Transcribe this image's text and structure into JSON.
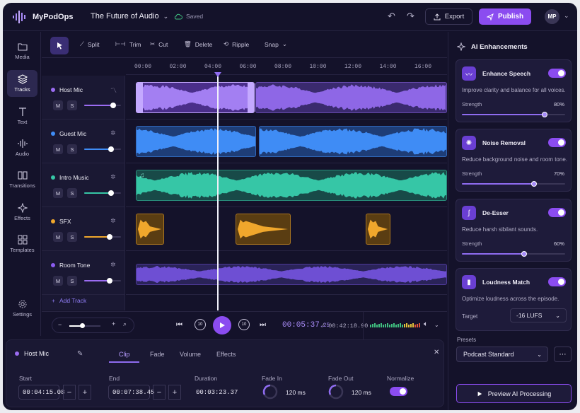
{
  "app": {
    "name": "MyPodOps",
    "doc_title": "The Future of Audio",
    "saved": "Saved"
  },
  "topbar": {
    "export": "Export",
    "publish": "Publish",
    "avatar": "MP"
  },
  "nav": [
    {
      "label": "Media",
      "icon": "folder-icon"
    },
    {
      "label": "Tracks",
      "icon": "layers-icon",
      "active": true
    },
    {
      "label": "Text",
      "icon": "text-icon"
    },
    {
      "label": "Audio",
      "icon": "waveform-icon"
    },
    {
      "label": "Transitions",
      "icon": "transitions-icon"
    },
    {
      "label": "Effects",
      "icon": "sparkle-icon"
    },
    {
      "label": "Templates",
      "icon": "grid-icon"
    },
    {
      "label": "Settings",
      "icon": "gear-icon"
    }
  ],
  "toolbar": {
    "split": "Split",
    "trim": "Trim",
    "cut": "Cut",
    "delete": "Delete",
    "ripple": "Ripple",
    "snap": "Snap"
  },
  "ruler": [
    "00:00",
    "02:00",
    "04:00",
    "06:00",
    "08:00",
    "10:00",
    "12:00",
    "14:00",
    "16:00"
  ],
  "tracks": [
    {
      "name": "Host Mic",
      "color": "#9b6cf2",
      "volume": 0.79
    },
    {
      "name": "Guest Mic",
      "color": "#3f8cf5",
      "volume": 0.73
    },
    {
      "name": "Intro Music",
      "color": "#36c6a6",
      "volume": 0.73
    },
    {
      "name": "SFX",
      "color": "#f0a72c",
      "volume": 0.69
    },
    {
      "name": "Room Tone",
      "color": "#8b5cf0",
      "volume": 0.69
    }
  ],
  "track_buttons": {
    "mute": "M",
    "solo": "S"
  },
  "add_track": "Add Track",
  "transport": {
    "current": "00:05:37",
    "current_frac": ".25",
    "total": "/ 00:42:18.90"
  },
  "clip_panel": {
    "track": "Host Mic",
    "tabs": [
      "Clip",
      "Fade",
      "Volume",
      "Effects"
    ],
    "start_label": "Start",
    "start": "00:04:15.08",
    "end_label": "End",
    "end": "00:07:38.45",
    "duration_label": "Duration",
    "duration": "00:03:23.37",
    "fade_in_label": "Fade In",
    "fade_in": "120 ms",
    "fade_out_label": "Fade Out",
    "fade_out": "120 ms",
    "normalize_label": "Normalize"
  },
  "ai": {
    "title": "AI Enhancements",
    "cards": [
      {
        "title": "Enhance Speech",
        "desc": "Improve clarity and balance for all voices.",
        "label": "Strength",
        "value": "80%",
        "level": 0.8
      },
      {
        "title": "Noise Removal",
        "desc": "Reduce background noise and room tone.",
        "label": "Strength",
        "value": "70%",
        "level": 0.7
      },
      {
        "title": "De-Esser",
        "desc": "Reduce harsh sibilant sounds.",
        "label": "Strength",
        "value": "60%",
        "level": 0.6
      },
      {
        "title": "Loudness Match",
        "desc": "Optimize loudness across the episode.",
        "label": "Target",
        "value": "-16 LUFS"
      }
    ],
    "presets_label": "Presets",
    "preset": "Podcast Standard",
    "preview": "Preview AI Processing"
  }
}
